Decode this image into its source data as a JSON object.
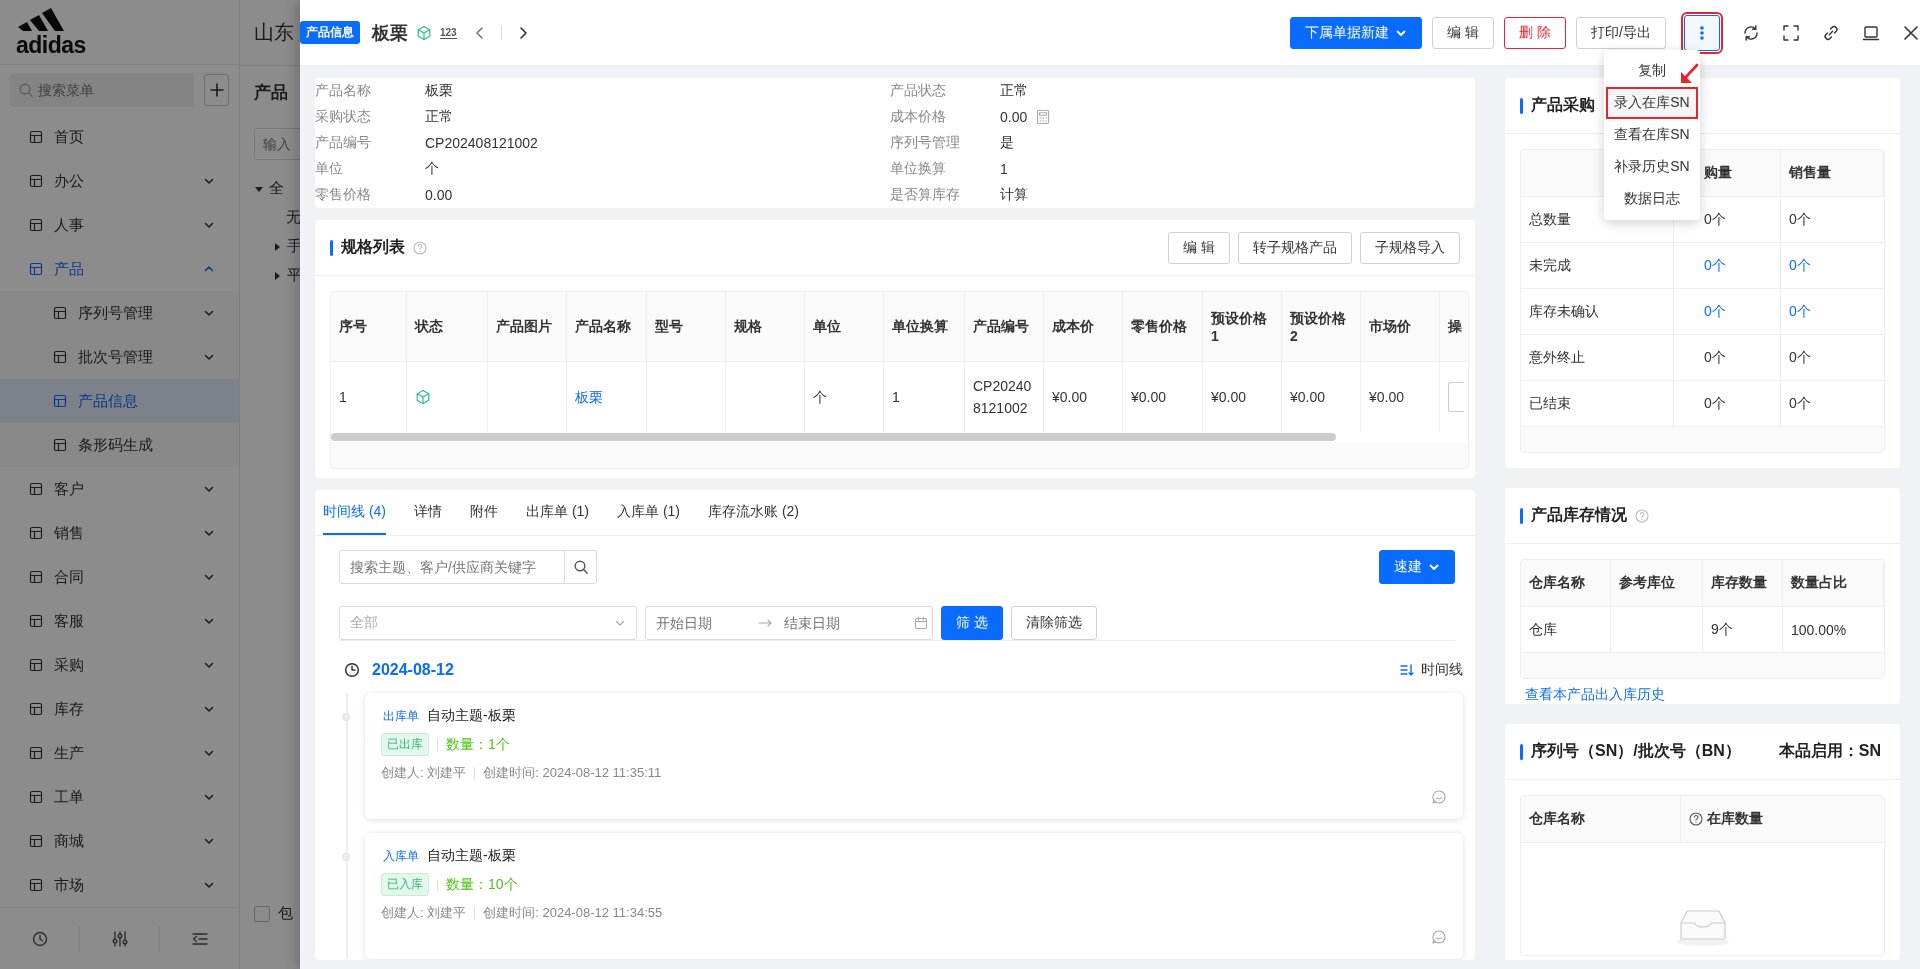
{
  "background_app": {
    "logo_text": "adidas",
    "company": "山东",
    "menu_search": {
      "placeholder": "搜索菜单"
    },
    "sidebar": {
      "items": [
        {
          "label": "首页",
          "selected": false
        },
        {
          "label": "办公",
          "expanded": false,
          "selected": false
        },
        {
          "label": "人事",
          "expanded": false,
          "selected": false
        },
        {
          "label": "产品",
          "expanded": true,
          "selected": false,
          "children": [
            {
              "label": "序列号管理",
              "expanded": false,
              "selected": false
            },
            {
              "label": "批次号管理",
              "expanded": false,
              "selected": false
            },
            {
              "label": "产品信息",
              "selected": true
            },
            {
              "label": "条形码生成",
              "selected": false
            }
          ]
        },
        {
          "label": "客户",
          "expanded": false,
          "selected": false
        },
        {
          "label": "销售",
          "expanded": false,
          "selected": false
        },
        {
          "label": "合同",
          "expanded": false,
          "selected": false
        },
        {
          "label": "客服",
          "expanded": false,
          "selected": false
        },
        {
          "label": "采购",
          "expanded": false,
          "selected": false
        },
        {
          "label": "库存",
          "expanded": false,
          "selected": false
        },
        {
          "label": "生产",
          "expanded": false,
          "selected": false
        },
        {
          "label": "工单",
          "expanded": false,
          "selected": false
        },
        {
          "label": "商城",
          "expanded": false,
          "selected": false
        },
        {
          "label": "市场",
          "expanded": false,
          "selected": false
        }
      ]
    },
    "panel": {
      "title": "产品",
      "search": {
        "placeholder": "输入"
      },
      "tree": [
        {
          "label": "全",
          "expanded": true,
          "children": [
            {
              "label": "无"
            },
            {
              "label": "手",
              "expanded": false
            },
            {
              "label": "平",
              "expanded": false
            }
          ]
        }
      ],
      "checkbox": {
        "label": "包",
        "checked": false
      }
    }
  },
  "drawer": {
    "header": {
      "badge": "产品信息",
      "title": "板栗",
      "number_label": "123",
      "buttons": [
        {
          "kind": "create",
          "label": "下属单据新建",
          "dropdown": true
        },
        {
          "kind": "edit",
          "label": "编 辑"
        },
        {
          "kind": "delete",
          "label": "删 除"
        },
        {
          "kind": "export",
          "label": "打印/导出"
        }
      ],
      "more_menu": {
        "open": true,
        "highlighted": true,
        "items": [
          {
            "label": "复制",
            "highlighted": false
          },
          {
            "label": "录入在库SN",
            "highlighted": true
          },
          {
            "label": "查看在库SN",
            "highlighted": false
          },
          {
            "label": "补录历史SN",
            "highlighted": false
          },
          {
            "label": "数据日志",
            "highlighted": false
          }
        ]
      }
    },
    "info": {
      "left_fields": [
        {
          "label": "产品名称",
          "value": "板栗",
          "kind": "text"
        },
        {
          "label": "采购状态",
          "value": "正常",
          "kind": "text"
        },
        {
          "label": "产品编号",
          "value": "CP202408121002",
          "kind": "text"
        },
        {
          "label": "单位",
          "value": "个",
          "kind": "text"
        },
        {
          "label": "零售价格",
          "value": "0.00",
          "kind": "text"
        }
      ],
      "right_fields": [
        {
          "label": "产品状态",
          "value": "正常",
          "kind": "text"
        },
        {
          "label": "成本价格",
          "value": "0.00",
          "kind": "calculator"
        },
        {
          "label": "序列号管理",
          "value": "是",
          "kind": "text"
        },
        {
          "label": "单位换算",
          "value": "1",
          "kind": "text"
        },
        {
          "label": "是否算库存",
          "value": "计算",
          "kind": "text"
        }
      ]
    },
    "spec": {
      "title": "规格列表",
      "buttons": [
        "编 辑",
        "转子规格产品",
        "子规格导入"
      ],
      "columns": [
        "序号",
        "状态",
        "产品图片",
        "产品名称",
        "型号",
        "规格",
        "单位",
        "单位换算",
        "产品编号",
        "成本价",
        "零售价格",
        "预设价格1",
        "预设价格2",
        "市场价",
        "操"
      ],
      "rows": [
        {
          "cells": [
            {
              "kind": "text",
              "text": "1"
            },
            {
              "kind": "status"
            },
            {
              "kind": "empty"
            },
            {
              "kind": "link",
              "text": "板栗"
            },
            {
              "kind": "empty"
            },
            {
              "kind": "empty"
            },
            {
              "kind": "text",
              "text": "个"
            },
            {
              "kind": "text",
              "text": "1"
            },
            {
              "kind": "text",
              "text": "CP202408121002"
            },
            {
              "kind": "text",
              "text": "¥0.00"
            },
            {
              "kind": "text",
              "text": "¥0.00"
            },
            {
              "kind": "text",
              "text": "¥0.00"
            },
            {
              "kind": "text",
              "text": "¥0.00"
            },
            {
              "kind": "text",
              "text": "¥0.00"
            },
            {
              "kind": "action"
            }
          ]
        }
      ]
    },
    "tabs": [
      {
        "label": "时间线 (4)",
        "selected": true
      },
      {
        "label": "详情",
        "selected": false
      },
      {
        "label": "附件",
        "selected": false
      },
      {
        "label": "出库单 (1)",
        "selected": false
      },
      {
        "label": "入库单 (1)",
        "selected": false
      },
      {
        "label": "库存流水账 (2)",
        "selected": false
      }
    ],
    "filters": {
      "search_placeholder": "搜索主题、客户/供应商关键字",
      "quick_button": "速建",
      "type_select": {
        "placeholder": "全部"
      },
      "date_range": {
        "start_placeholder": "开始日期",
        "end_placeholder": "结束日期"
      },
      "filter_button": "筛 选",
      "clear_button": "清除筛选"
    },
    "timeline": {
      "date": "2024-08-12",
      "view_toggle": "时间线",
      "entries": [
        {
          "type": "出库单",
          "title": "自动主题-板栗",
          "status": "已出库",
          "quantity": "数量：1个",
          "creator": "创建人: 刘建平",
          "created": "创建时间: 2024-08-12 11:35:11"
        },
        {
          "type": "入库单",
          "title": "自动主题-板栗",
          "status": "已入库",
          "quantity": "数量：10个",
          "creator": "创建人: 刘建平",
          "created": "创建时间: 2024-08-12 11:34:55"
        }
      ]
    },
    "purchase_sales": {
      "title": "产品采购",
      "columns": [
        "购量",
        "销售量"
      ],
      "rows": [
        {
          "label": "总数量",
          "purchase": "0个",
          "sales": "0个",
          "link": false
        },
        {
          "label": "未完成",
          "purchase": "0个",
          "sales": "0个",
          "link": true
        },
        {
          "label": "库存未确认",
          "purchase": "0个",
          "sales": "0个",
          "link": true
        },
        {
          "label": "意外终止",
          "purchase": "0个",
          "sales": "0个",
          "link": false
        },
        {
          "label": "已结束",
          "purchase": "0个",
          "sales": "0个",
          "link": false
        }
      ]
    },
    "stock": {
      "title": "产品库存情况",
      "columns": [
        "仓库名称",
        "参考库位",
        "库存数量",
        "数量占比"
      ],
      "rows": [
        {
          "warehouse": "仓库",
          "quantity": "9个",
          "share": "100.00%"
        }
      ],
      "history_link": "查看本产品出入库历史"
    },
    "serial": {
      "title": "序列号（SN）/批次号（BN）",
      "mode": "本品启用：SN",
      "columns": [
        "仓库名称",
        "在库数量"
      ],
      "empty": true
    }
  }
}
